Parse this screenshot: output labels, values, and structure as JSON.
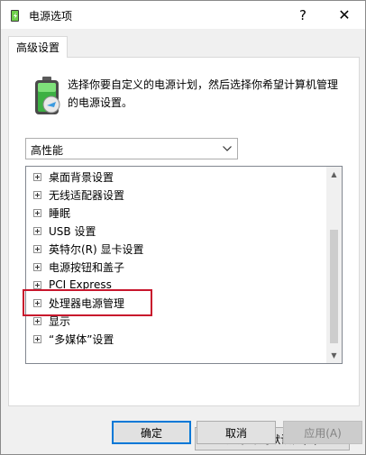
{
  "window": {
    "title": "电源选项",
    "help_glyph": "?",
    "close_glyph": "✕"
  },
  "tabs": [
    "高级设置"
  ],
  "description": "选择你要自定义的电源计划，然后选择你希望计算机管理的电源设置。",
  "plan_select": {
    "value": "高性能"
  },
  "tree_items": [
    "桌面背景设置",
    "无线适配器设置",
    "睡眠",
    "USB 设置",
    "英特尔(R) 显卡设置",
    "电源按钮和盖子",
    "PCI Express",
    "处理器电源管理",
    "显示",
    "“多媒体”设置"
  ],
  "scrollbar": {
    "up_glyph": "▲",
    "down_glyph": "▼"
  },
  "buttons": {
    "restore": "还原计划默认值(R)",
    "ok": "确定",
    "cancel": "取消",
    "apply": "应用(A)"
  },
  "colors": {
    "highlight": "#c8162c",
    "accent": "#0078d7"
  }
}
